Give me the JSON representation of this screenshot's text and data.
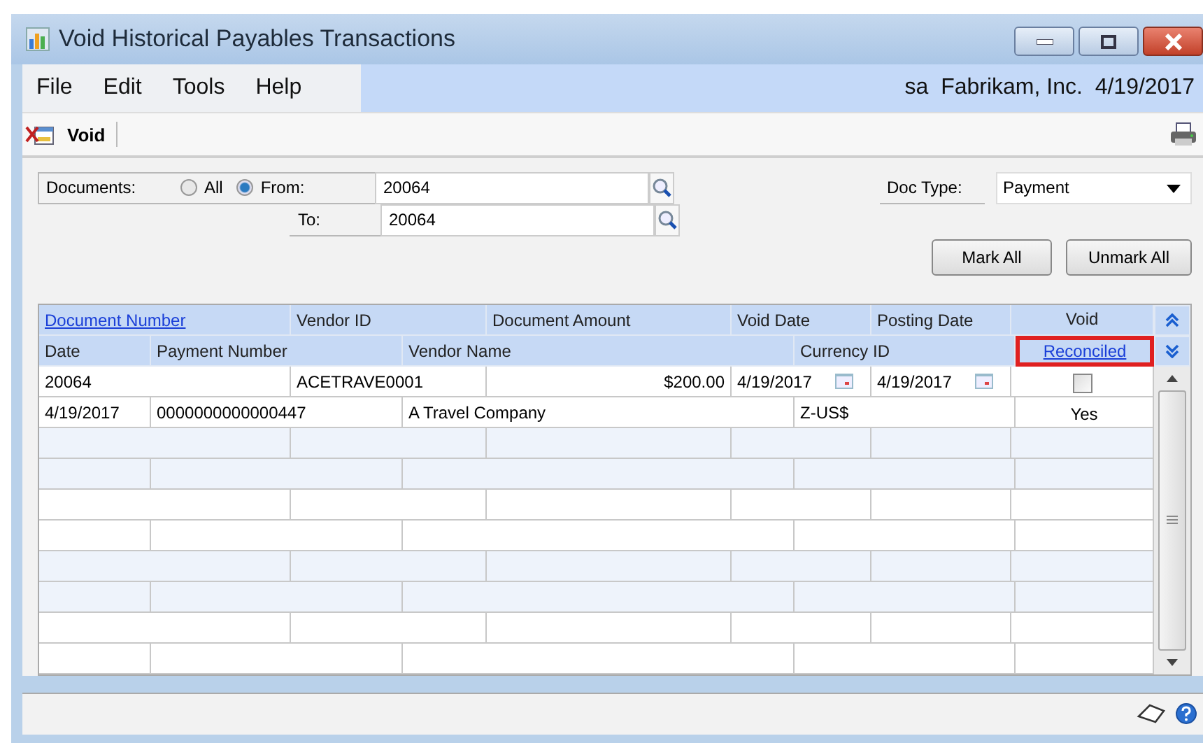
{
  "window": {
    "title": "Void Historical Payables Transactions"
  },
  "menu": [
    "File",
    "Edit",
    "Tools",
    "Help"
  ],
  "user_info": "sa  Fabrikam, Inc.  4/19/2017",
  "toolbar": {
    "void_button": "Void"
  },
  "filter": {
    "documents_label": "Documents:",
    "options": [
      {
        "label": "All",
        "selected": false
      },
      {
        "label": "From:",
        "selected": true
      }
    ],
    "from": "20064",
    "to_label": "To:",
    "to": "20064",
    "doc_type_label": "Doc Type:",
    "doc_type": "Payment"
  },
  "buttons": [
    "Mark All",
    "Unmark All"
  ],
  "table": {
    "columns_line1": [
      "Document Number",
      "Vendor ID",
      "Document Amount",
      "Void Date",
      "Posting Date",
      "Void"
    ],
    "columns_line2": [
      "Date",
      "Payment Number",
      "Vendor Name",
      "Currency ID",
      "Reconciled"
    ],
    "rows": [
      {
        "document_number": "20064",
        "vendor_id": "ACETRAVE0001",
        "document_amount": "$200.00",
        "void_date": "4/19/2017",
        "posting_date": "4/19/2017",
        "void": false,
        "date": "4/19/2017",
        "payment_number": "0000000000000447",
        "vendor_name": "A Travel Company",
        "currency_id": "Z-US$",
        "reconciled": "Yes"
      }
    ]
  }
}
